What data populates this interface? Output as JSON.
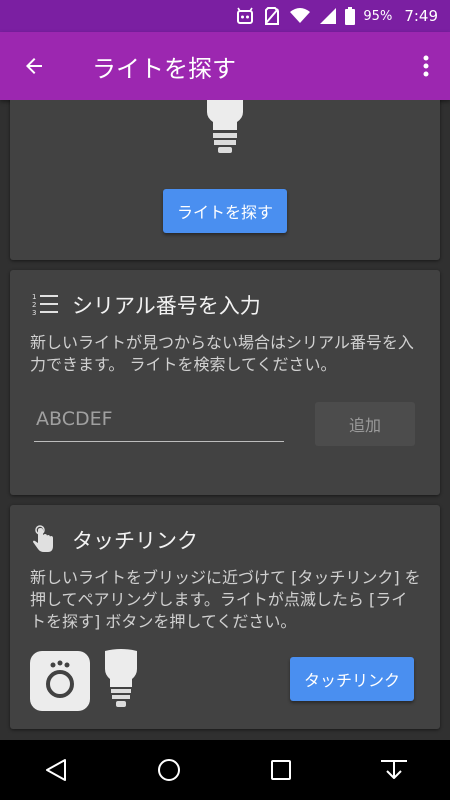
{
  "status_bar": {
    "battery": "95%",
    "time": "7:49"
  },
  "app_bar": {
    "title": "ライトを探す"
  },
  "search_card": {
    "button_label": "ライトを探す"
  },
  "serial_card": {
    "title": "シリアル番号を入力",
    "description": "新しいライトが見つからない場合はシリアル番号を入力できます。 ライトを検索してください。",
    "input_placeholder": "ABCDEF",
    "input_value": "",
    "add_button": "追加"
  },
  "touchlink_card": {
    "title": "タッチリンク",
    "description": "新しいライトをブリッジに近づけて [タッチリンク] を押してペアリングします。ライトが点滅したら [ライトを探す] ボタンを押してください。",
    "button_label": "タッチリンク"
  },
  "colors": {
    "status_bar": "#7b1fa2",
    "app_bar": "#9c27b0",
    "card": "#424242",
    "accent": "#4a8ff0"
  }
}
